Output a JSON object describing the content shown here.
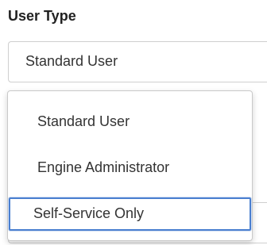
{
  "user_type": {
    "label": "User Type",
    "selected_value": "Standard User",
    "options": [
      {
        "label": "Standard User",
        "highlighted": false
      },
      {
        "label": "Engine Administrator",
        "highlighted": false
      },
      {
        "label": "Self-Service Only",
        "highlighted": true
      }
    ]
  },
  "colors": {
    "focus_ring": "#4a7fd0",
    "border": "#cfcfcf",
    "text": "#333333"
  }
}
